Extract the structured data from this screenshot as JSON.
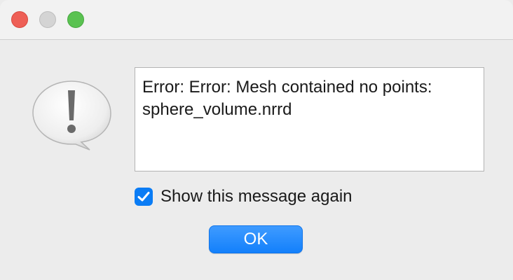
{
  "window": {
    "controls": [
      "close-button",
      "minimize-button",
      "zoom-button"
    ]
  },
  "alert": {
    "icon": "exclamation-speech-bubble-icon",
    "message": "Error: Error: Mesh contained no points: sphere_volume.nrrd"
  },
  "checkbox": {
    "label": "Show this message again",
    "checked": true
  },
  "buttons": {
    "ok_label": "OK"
  },
  "colors": {
    "accent": "#0a7cf5",
    "close": "#ee5f56",
    "minimize": "#d4d4d4",
    "zoom": "#5ac251"
  }
}
